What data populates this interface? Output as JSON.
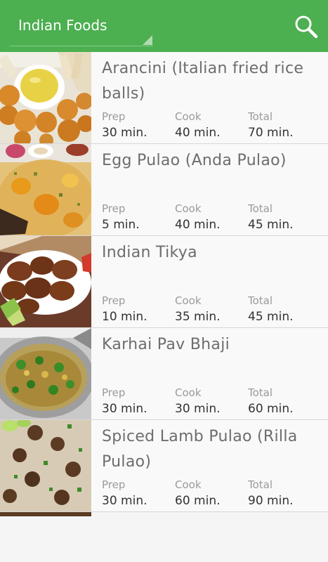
{
  "app": {
    "spinner_label": "Indian Foods"
  },
  "colors": {
    "app_bar": "#4caf50",
    "title_text": "#6d6d6d",
    "label_text": "#9a9a9a",
    "value_text": "#333333"
  },
  "icons": {
    "search": "search-icon",
    "spinner": "dropdown-arrow-icon"
  },
  "recipes": [
    {
      "title": "Arancini (Italian fried rice balls)",
      "prep_label": "Prep",
      "prep": "30 min.",
      "cook_label": "Cook",
      "cook": "40 min.",
      "total_label": "Total",
      "total": "70 min."
    },
    {
      "title": "Egg Pulao (Anda Pulao)",
      "prep_label": "Prep",
      "prep": "5 min.",
      "cook_label": "Cook",
      "cook": "40 min.",
      "total_label": "Total",
      "total": "45 min."
    },
    {
      "title": "Indian Tikya",
      "prep_label": "Prep",
      "prep": "10 min.",
      "cook_label": "Cook",
      "cook": "35 min.",
      "total_label": "Total",
      "total": "45 min."
    },
    {
      "title": "Karhai Pav Bhaji",
      "prep_label": "Prep",
      "prep": "30 min.",
      "cook_label": "Cook",
      "cook": "30 min.",
      "total_label": "Total",
      "total": "60 min."
    },
    {
      "title": "Spiced Lamb Pulao (Rilla Pulao)",
      "prep_label": "Prep",
      "prep": "30 min.",
      "cook_label": "Cook",
      "cook": "60 min.",
      "total_label": "Total",
      "total": "90 min."
    }
  ]
}
